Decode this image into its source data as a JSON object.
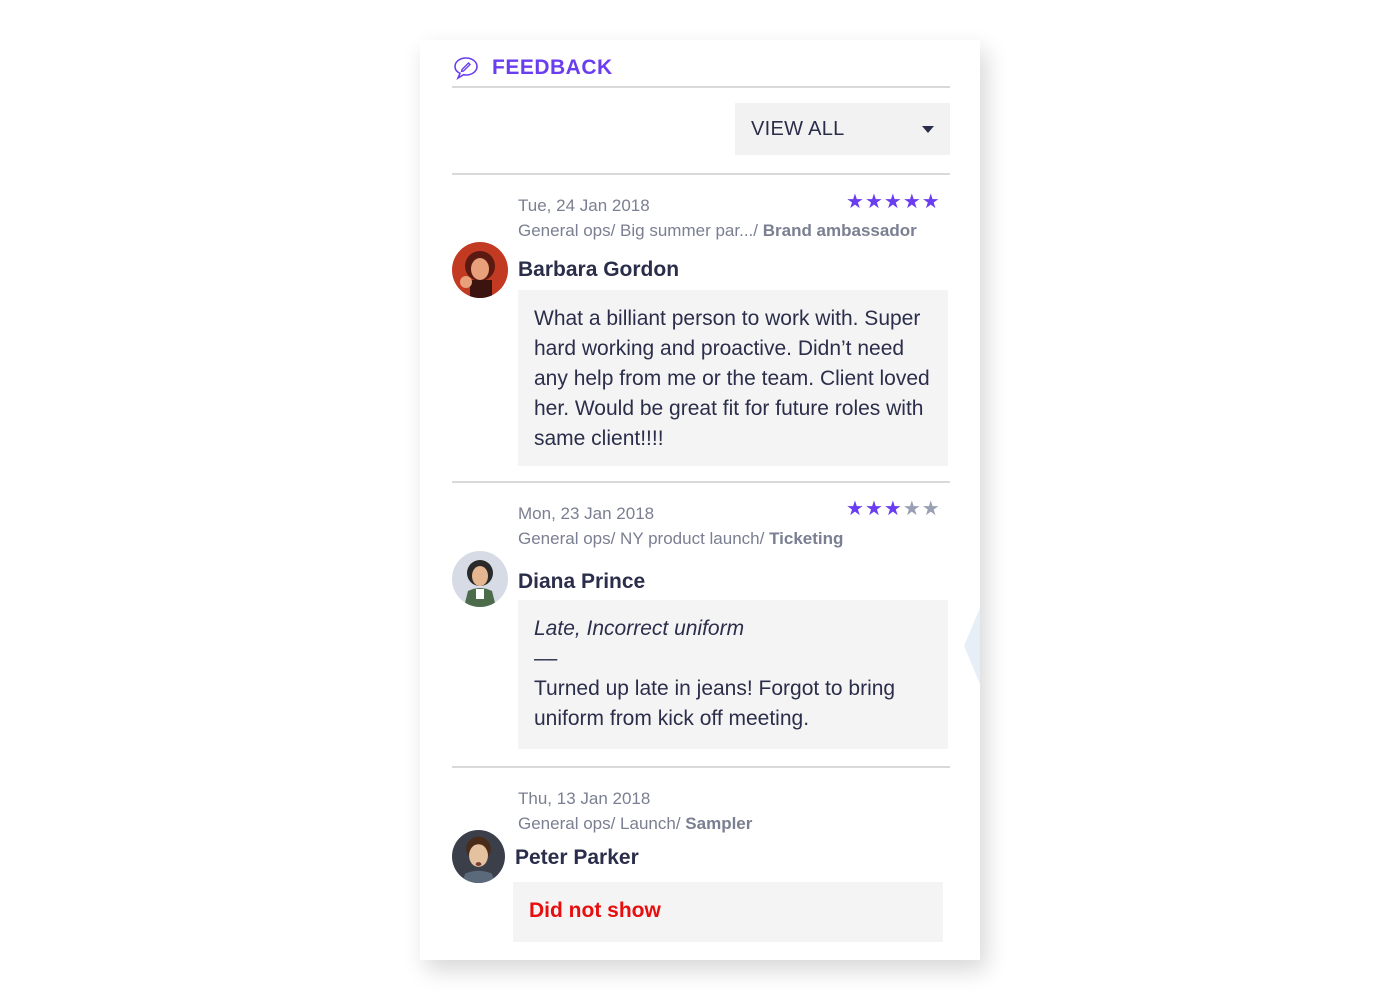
{
  "header": {
    "title": "FEEDBACK",
    "icon": "chat-pen-icon",
    "accent": "#6b3df0"
  },
  "filter": {
    "selected": "VIEW ALL"
  },
  "entries": [
    {
      "date": "Tue, 24 Jan 2018",
      "path": "General ops/ Big summer par.../ ",
      "role": "Brand ambassador",
      "name": "Barbara Gordon",
      "rating": 5,
      "comment": "What a billiant person to work with. Super hard working and proactive. Didn’t need any help from me or the team. Client loved her. Would be great fit for future roles with same client!!!!"
    },
    {
      "date": "Mon, 23 Jan 2018",
      "path": "General ops/ NY product launch/ ",
      "role": "Ticketing",
      "name": "Diana Prince",
      "rating": 3,
      "reason": "Late, Incorrect uniform",
      "separator": "––",
      "comment": "Turned up late in jeans! Forgot to bring uniform from kick off meeting."
    },
    {
      "date": "Thu, 13 Jan 2018",
      "path": "General ops/ Launch/ ",
      "role": "Sampler",
      "name": "Peter Parker",
      "status": "Did not show",
      "status_color": "#e80e0e"
    }
  ]
}
